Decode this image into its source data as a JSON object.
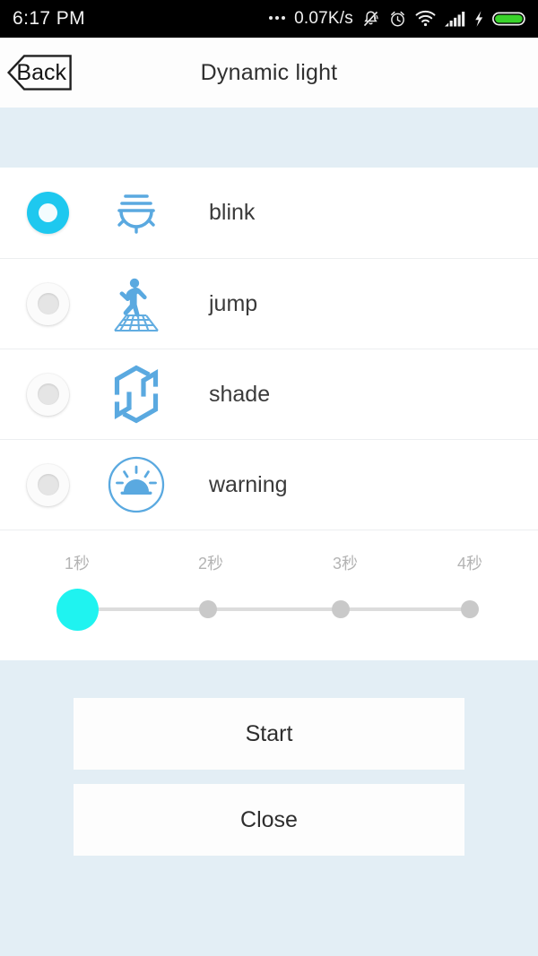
{
  "statusbar": {
    "time": "6:17 PM",
    "network_speed": "0.07K/s",
    "icons": [
      "overflow-dots",
      "mute-bell-icon",
      "alarm-clock-icon",
      "wifi-icon",
      "signal-bars-icon",
      "charging-bolt-icon",
      "battery-icon"
    ],
    "battery_color": "#39d32a"
  },
  "titlebar": {
    "back_label": "Back",
    "title": "Dynamic light"
  },
  "options": [
    {
      "label": "blink",
      "icon": "lamp-icon",
      "selected": true
    },
    {
      "label": "jump",
      "icon": "dancer-grid-icon",
      "selected": false
    },
    {
      "label": "shade",
      "icon": "hexagon-spiral-icon",
      "selected": false
    },
    {
      "label": "warning",
      "icon": "beacon-sun-icon",
      "selected": false
    }
  ],
  "slider": {
    "ticks": [
      "1秒",
      "2秒",
      "3秒",
      "4秒"
    ],
    "selected_index": 0,
    "thumb_color": "#1ff3f0",
    "track_color": "#dcdcdc"
  },
  "actions": {
    "start_label": "Start",
    "close_label": "Close"
  },
  "colors": {
    "accent": "#1ec8ef",
    "page_background": "#e3eef5",
    "card_background": "#ffffff"
  }
}
